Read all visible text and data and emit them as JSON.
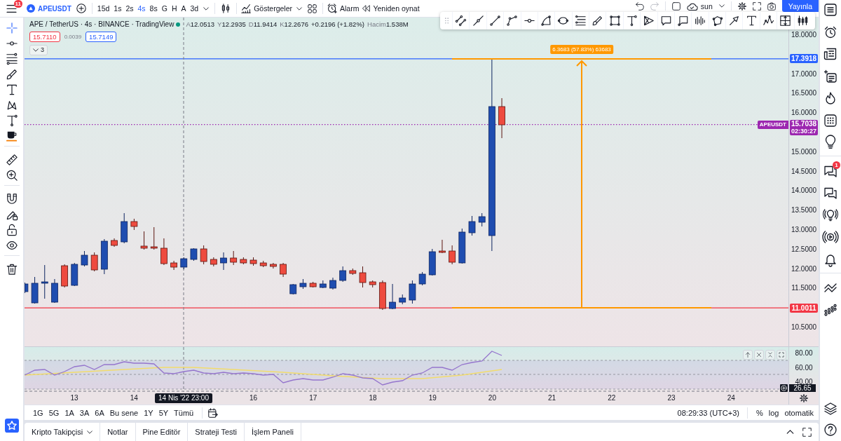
{
  "top_bar": {
    "menu_badge": "11",
    "symbol": "APEUSDT",
    "intervals": [
      {
        "label": "15d",
        "selected": false
      },
      {
        "label": "1s",
        "selected": false
      },
      {
        "label": "2s",
        "selected": false
      },
      {
        "label": "4s",
        "selected": true
      },
      {
        "label": "8s",
        "selected": false
      },
      {
        "label": "G",
        "selected": false
      },
      {
        "label": "H",
        "selected": false
      },
      {
        "label": "A",
        "selected": false
      },
      {
        "label": "3d",
        "selected": false
      }
    ],
    "indicators": "Göstergeler",
    "alert": "Alarm",
    "replay": "Yeniden oynat",
    "undo_disabled": false,
    "redo_disabled": true,
    "layout_name": "sun",
    "publish": "Yayınla"
  },
  "left_toolbar": {
    "tools": [
      {
        "selected": true
      },
      {
        "selected": false
      },
      {
        "selected": false
      },
      {
        "selected": false
      },
      {
        "selected": false
      },
      {
        "selected": false
      },
      {
        "selected": false
      },
      {
        "selected": false
      },
      {
        "selected": false
      },
      {
        "selected": false
      },
      {
        "selected": false
      },
      {
        "selected": false
      },
      {
        "selected": false
      },
      {
        "selected": false
      },
      {
        "selected": false
      }
    ]
  },
  "legend": {
    "title": "APE / TetherUS · 4s · BINANCE · TradingView",
    "market_open": true,
    "ohlc": [
      {
        "label": "A",
        "value": "12.0513"
      },
      {
        "label": "Y",
        "value": "12.2935"
      },
      {
        "label": "D",
        "value": "11.9414"
      },
      {
        "label": "K",
        "value": "12.2676"
      }
    ],
    "change": "+0.2196 (+1.82%)",
    "volume_label": "Hacim",
    "volume": "1.538M",
    "sell_price": "15.7110",
    "spread": "0.0039",
    "buy_price": "15.7149",
    "indicators_count": "3"
  },
  "chart": {
    "price_ticks": [
      "18.0000",
      "17.0000",
      "16.5000",
      "16.0000",
      "15.0000",
      "14.5000",
      "14.0000",
      "13.5000",
      "13.0000",
      "12.5000",
      "12.0000",
      "11.5000",
      "10.5000"
    ],
    "lines": [
      {
        "kind": "horizontal",
        "price": "17.3918",
        "color": "#2962ff"
      },
      {
        "kind": "last_price",
        "price": "15.7038",
        "countdown": "02:30:27",
        "tag": "APEUSDT",
        "color": "#9c27b0"
      },
      {
        "kind": "horizontal",
        "price": "11.0011",
        "color": "#f23645"
      }
    ],
    "price_range_label": "6.3683 (57.83%) 63683",
    "time_ticks": [
      "13",
      "14",
      "16",
      "17",
      "18",
      "19",
      "20",
      "21",
      "22",
      "23",
      "24"
    ],
    "crosshair_time": "14 Nis '22 23:00"
  },
  "rsi_pane": {
    "ticks": [
      "80.00",
      "60.00",
      "40.00"
    ],
    "crosshair_value": "26.65"
  },
  "range_bar": {
    "ranges": [
      "1G",
      "5G",
      "1A",
      "3A",
      "6A",
      "Bu sene",
      "1Y",
      "5Y",
      "Tümü"
    ],
    "clock": "08:29:33 (UTC+3)",
    "scale_options": [
      "%",
      "log",
      "otomatik"
    ]
  },
  "bottom_panel": {
    "tabs": [
      {
        "label": "Kripto Takipçisi",
        "selected": false,
        "dropdown": true
      },
      {
        "label": "Notlar",
        "selected": false,
        "dropdown": false
      },
      {
        "label": "Pine Editör",
        "selected": false,
        "dropdown": false
      },
      {
        "label": "Strateji Testi",
        "selected": false,
        "dropdown": false
      },
      {
        "label": "İşlem Paneli",
        "selected": false,
        "dropdown": false
      }
    ]
  },
  "right_sidebar": {
    "chat_badge": "1"
  }
}
